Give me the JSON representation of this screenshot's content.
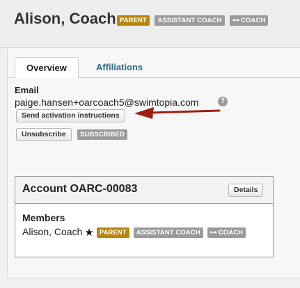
{
  "header": {
    "title": "Alison, Coach",
    "badges": {
      "parent": "PARENT",
      "assistant_coach": "ASSISTANT COACH",
      "coach": "COACH"
    }
  },
  "tabs": {
    "overview": "Overview",
    "affiliations": "Affiliations"
  },
  "overview": {
    "email_label": "Email",
    "email_value": "paige.hansen+oarcoach5@swimtopia.com",
    "help_glyph": "?",
    "send_activation_label": "Send activation instructions",
    "unsubscribe_label": "Unsubscribe",
    "subscription_status": "SUBSCRIBED"
  },
  "account": {
    "title": "Account OARC-00083",
    "details_label": "Details",
    "members_label": "Members",
    "member": {
      "name": "Alison, Coach",
      "star": "★",
      "badges": {
        "parent": "PARENT",
        "assistant_coach": "ASSISTANT COACH",
        "coach": "COACH"
      }
    }
  },
  "icons": {
    "key": "key-icon",
    "help": "question-circle-icon",
    "star": "star-icon",
    "arrow": "annotation-arrow-icon"
  },
  "colors": {
    "parent_badge": "#b8860b",
    "role_badge": "#999b9e",
    "tab_link": "#2b6d8c",
    "arrow": "#a01e14"
  }
}
